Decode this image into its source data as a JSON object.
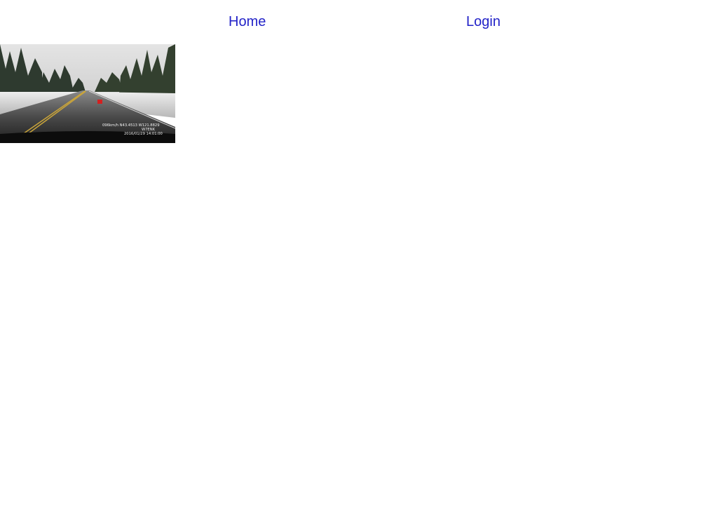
{
  "nav": {
    "home_label": "Home",
    "login_label": "Login",
    "link_color": "#2323c8"
  },
  "thumbnail": {
    "overlay_line1": "096km/h N43.4513 W121.8829",
    "overlay_line2": "W7ENK",
    "overlay_line3": "2016/01/29 14:01:00"
  }
}
